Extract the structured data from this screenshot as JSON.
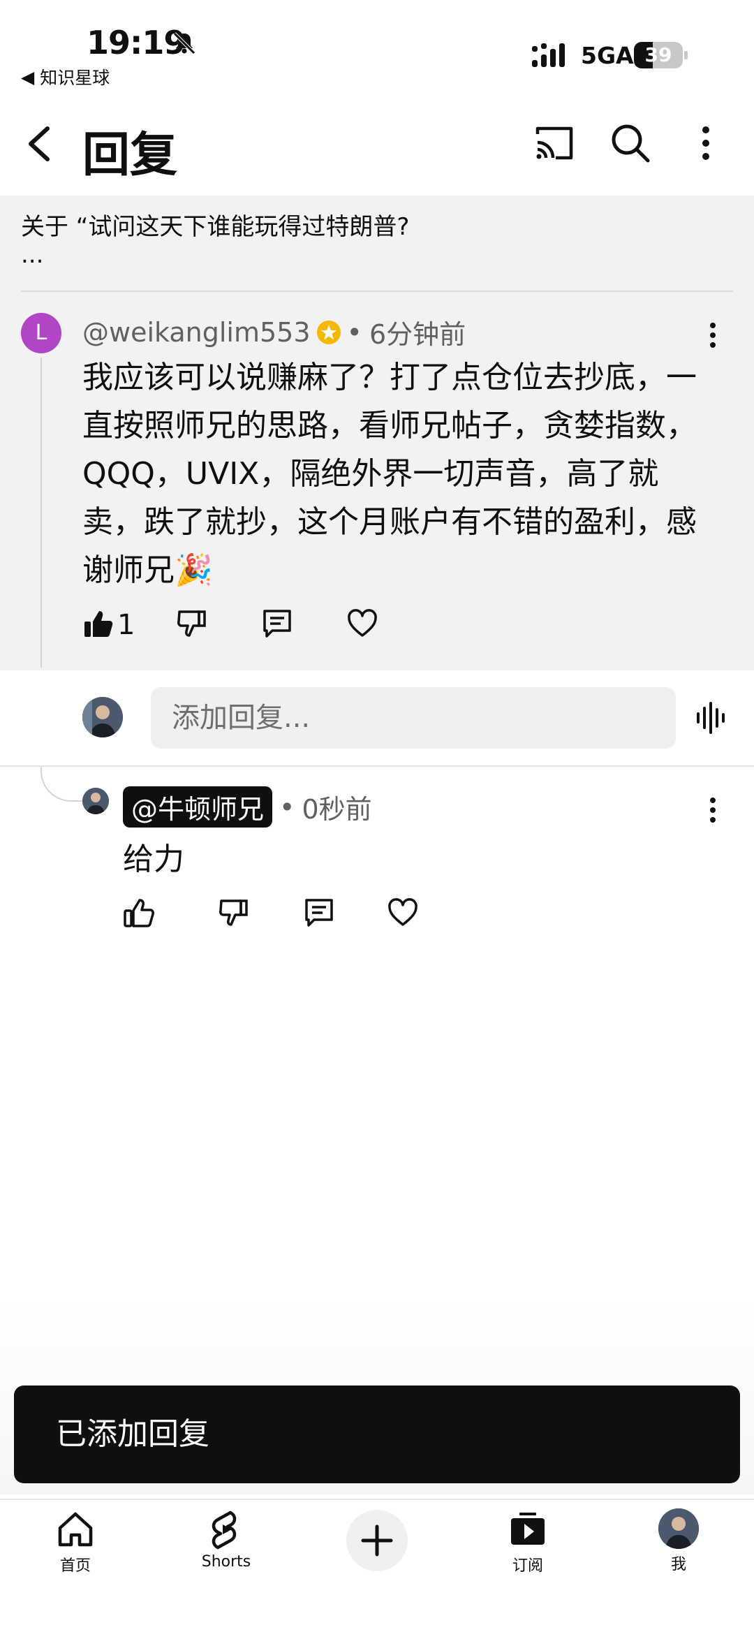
{
  "status_bar": {
    "time": "19:19",
    "back_app": "知识星球",
    "network": "5GA",
    "battery": "39",
    "battery_level": 0.39
  },
  "header": {
    "title": "回复"
  },
  "about_text": "关于 “试问这天下谁能玩得过特朗普?",
  "about_ellipsis": "...",
  "comment": {
    "avatar_letter": "L",
    "author": "@weikanglim553",
    "separator": "•",
    "time": "6分钟前",
    "text": "我应该可以说赚麻了？打了点仓位去抄底，一直按照师兄的思路，看师兄帖子，贪婪指数，QQQ，UVIX，隔绝外界一切声音，高了就卖，跌了就抄，这个月账户有不错的盈利，感谢师兄🎉",
    "likes": "1"
  },
  "reply_input": {
    "placeholder": "添加回复..."
  },
  "reply": {
    "author": "@牛顿师兄",
    "separator": "•",
    "time": "0秒前",
    "text": "给力"
  },
  "toast": "已添加回复",
  "nav": {
    "home": "首页",
    "shorts": "Shorts",
    "subscriptions": "订阅",
    "me": "我"
  },
  "colors": {
    "accent_avatar": "#b046c4",
    "gray_bg": "#f2f2f2",
    "toast_bg": "#0f0f0f"
  }
}
